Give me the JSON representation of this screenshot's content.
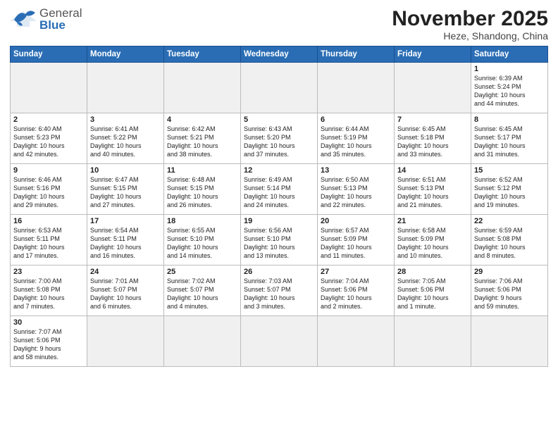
{
  "header": {
    "logo_general": "General",
    "logo_blue": "Blue",
    "month_year": "November 2025",
    "location": "Heze, Shandong, China"
  },
  "weekdays": [
    "Sunday",
    "Monday",
    "Tuesday",
    "Wednesday",
    "Thursday",
    "Friday",
    "Saturday"
  ],
  "weeks": [
    [
      {
        "day": "",
        "info": "",
        "empty": true
      },
      {
        "day": "",
        "info": "",
        "empty": true
      },
      {
        "day": "",
        "info": "",
        "empty": true
      },
      {
        "day": "",
        "info": "",
        "empty": true
      },
      {
        "day": "",
        "info": "",
        "empty": true
      },
      {
        "day": "",
        "info": "",
        "empty": true
      },
      {
        "day": "1",
        "info": "Sunrise: 6:39 AM\nSunset: 5:24 PM\nDaylight: 10 hours\nand 44 minutes."
      }
    ],
    [
      {
        "day": "2",
        "info": "Sunrise: 6:40 AM\nSunset: 5:23 PM\nDaylight: 10 hours\nand 42 minutes."
      },
      {
        "day": "3",
        "info": "Sunrise: 6:41 AM\nSunset: 5:22 PM\nDaylight: 10 hours\nand 40 minutes."
      },
      {
        "day": "4",
        "info": "Sunrise: 6:42 AM\nSunset: 5:21 PM\nDaylight: 10 hours\nand 38 minutes."
      },
      {
        "day": "5",
        "info": "Sunrise: 6:43 AM\nSunset: 5:20 PM\nDaylight: 10 hours\nand 37 minutes."
      },
      {
        "day": "6",
        "info": "Sunrise: 6:44 AM\nSunset: 5:19 PM\nDaylight: 10 hours\nand 35 minutes."
      },
      {
        "day": "7",
        "info": "Sunrise: 6:45 AM\nSunset: 5:18 PM\nDaylight: 10 hours\nand 33 minutes."
      },
      {
        "day": "8",
        "info": "Sunrise: 6:45 AM\nSunset: 5:17 PM\nDaylight: 10 hours\nand 31 minutes."
      }
    ],
    [
      {
        "day": "9",
        "info": "Sunrise: 6:46 AM\nSunset: 5:16 PM\nDaylight: 10 hours\nand 29 minutes."
      },
      {
        "day": "10",
        "info": "Sunrise: 6:47 AM\nSunset: 5:15 PM\nDaylight: 10 hours\nand 27 minutes."
      },
      {
        "day": "11",
        "info": "Sunrise: 6:48 AM\nSunset: 5:15 PM\nDaylight: 10 hours\nand 26 minutes."
      },
      {
        "day": "12",
        "info": "Sunrise: 6:49 AM\nSunset: 5:14 PM\nDaylight: 10 hours\nand 24 minutes."
      },
      {
        "day": "13",
        "info": "Sunrise: 6:50 AM\nSunset: 5:13 PM\nDaylight: 10 hours\nand 22 minutes."
      },
      {
        "day": "14",
        "info": "Sunrise: 6:51 AM\nSunset: 5:13 PM\nDaylight: 10 hours\nand 21 minutes."
      },
      {
        "day": "15",
        "info": "Sunrise: 6:52 AM\nSunset: 5:12 PM\nDaylight: 10 hours\nand 19 minutes."
      }
    ],
    [
      {
        "day": "16",
        "info": "Sunrise: 6:53 AM\nSunset: 5:11 PM\nDaylight: 10 hours\nand 17 minutes."
      },
      {
        "day": "17",
        "info": "Sunrise: 6:54 AM\nSunset: 5:11 PM\nDaylight: 10 hours\nand 16 minutes."
      },
      {
        "day": "18",
        "info": "Sunrise: 6:55 AM\nSunset: 5:10 PM\nDaylight: 10 hours\nand 14 minutes."
      },
      {
        "day": "19",
        "info": "Sunrise: 6:56 AM\nSunset: 5:10 PM\nDaylight: 10 hours\nand 13 minutes."
      },
      {
        "day": "20",
        "info": "Sunrise: 6:57 AM\nSunset: 5:09 PM\nDaylight: 10 hours\nand 11 minutes."
      },
      {
        "day": "21",
        "info": "Sunrise: 6:58 AM\nSunset: 5:09 PM\nDaylight: 10 hours\nand 10 minutes."
      },
      {
        "day": "22",
        "info": "Sunrise: 6:59 AM\nSunset: 5:08 PM\nDaylight: 10 hours\nand 8 minutes."
      }
    ],
    [
      {
        "day": "23",
        "info": "Sunrise: 7:00 AM\nSunset: 5:08 PM\nDaylight: 10 hours\nand 7 minutes."
      },
      {
        "day": "24",
        "info": "Sunrise: 7:01 AM\nSunset: 5:07 PM\nDaylight: 10 hours\nand 6 minutes."
      },
      {
        "day": "25",
        "info": "Sunrise: 7:02 AM\nSunset: 5:07 PM\nDaylight: 10 hours\nand 4 minutes."
      },
      {
        "day": "26",
        "info": "Sunrise: 7:03 AM\nSunset: 5:07 PM\nDaylight: 10 hours\nand 3 minutes."
      },
      {
        "day": "27",
        "info": "Sunrise: 7:04 AM\nSunset: 5:06 PM\nDaylight: 10 hours\nand 2 minutes."
      },
      {
        "day": "28",
        "info": "Sunrise: 7:05 AM\nSunset: 5:06 PM\nDaylight: 10 hours\nand 1 minute."
      },
      {
        "day": "29",
        "info": "Sunrise: 7:06 AM\nSunset: 5:06 PM\nDaylight: 9 hours\nand 59 minutes."
      }
    ],
    [
      {
        "day": "30",
        "info": "Sunrise: 7:07 AM\nSunset: 5:06 PM\nDaylight: 9 hours\nand 58 minutes."
      },
      {
        "day": "",
        "info": "",
        "empty": true
      },
      {
        "day": "",
        "info": "",
        "empty": true
      },
      {
        "day": "",
        "info": "",
        "empty": true
      },
      {
        "day": "",
        "info": "",
        "empty": true
      },
      {
        "day": "",
        "info": "",
        "empty": true
      },
      {
        "day": "",
        "info": "",
        "empty": true
      }
    ]
  ]
}
